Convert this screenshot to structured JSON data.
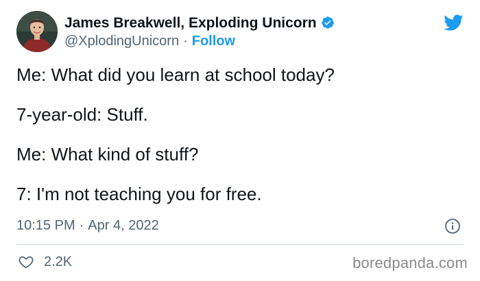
{
  "author": {
    "name": "James Breakwell, Exploding Unicorn",
    "handle": "@XplodingUnicorn",
    "separator": "·",
    "follow_label": "Follow",
    "verified": true
  },
  "tweet": {
    "lines": [
      "Me: What did you learn at school today?",
      "7-year-old: Stuff.",
      "Me: What kind of stuff?",
      "7: I'm not teaching you for free."
    ],
    "time": "10:15 PM",
    "date_separator": "·",
    "date": "Apr 4, 2022"
  },
  "actions": {
    "like_count": "2.2K"
  },
  "watermark": "boredpanda.com",
  "icons": {
    "twitter_logo": "twitter-bird-icon",
    "verified": "verified-badge-icon",
    "info": "info-icon",
    "like": "heart-icon"
  },
  "colors": {
    "text_primary": "#0f1419",
    "text_secondary": "#536471",
    "accent": "#1d9bf0",
    "divider": "#cfd9de"
  }
}
